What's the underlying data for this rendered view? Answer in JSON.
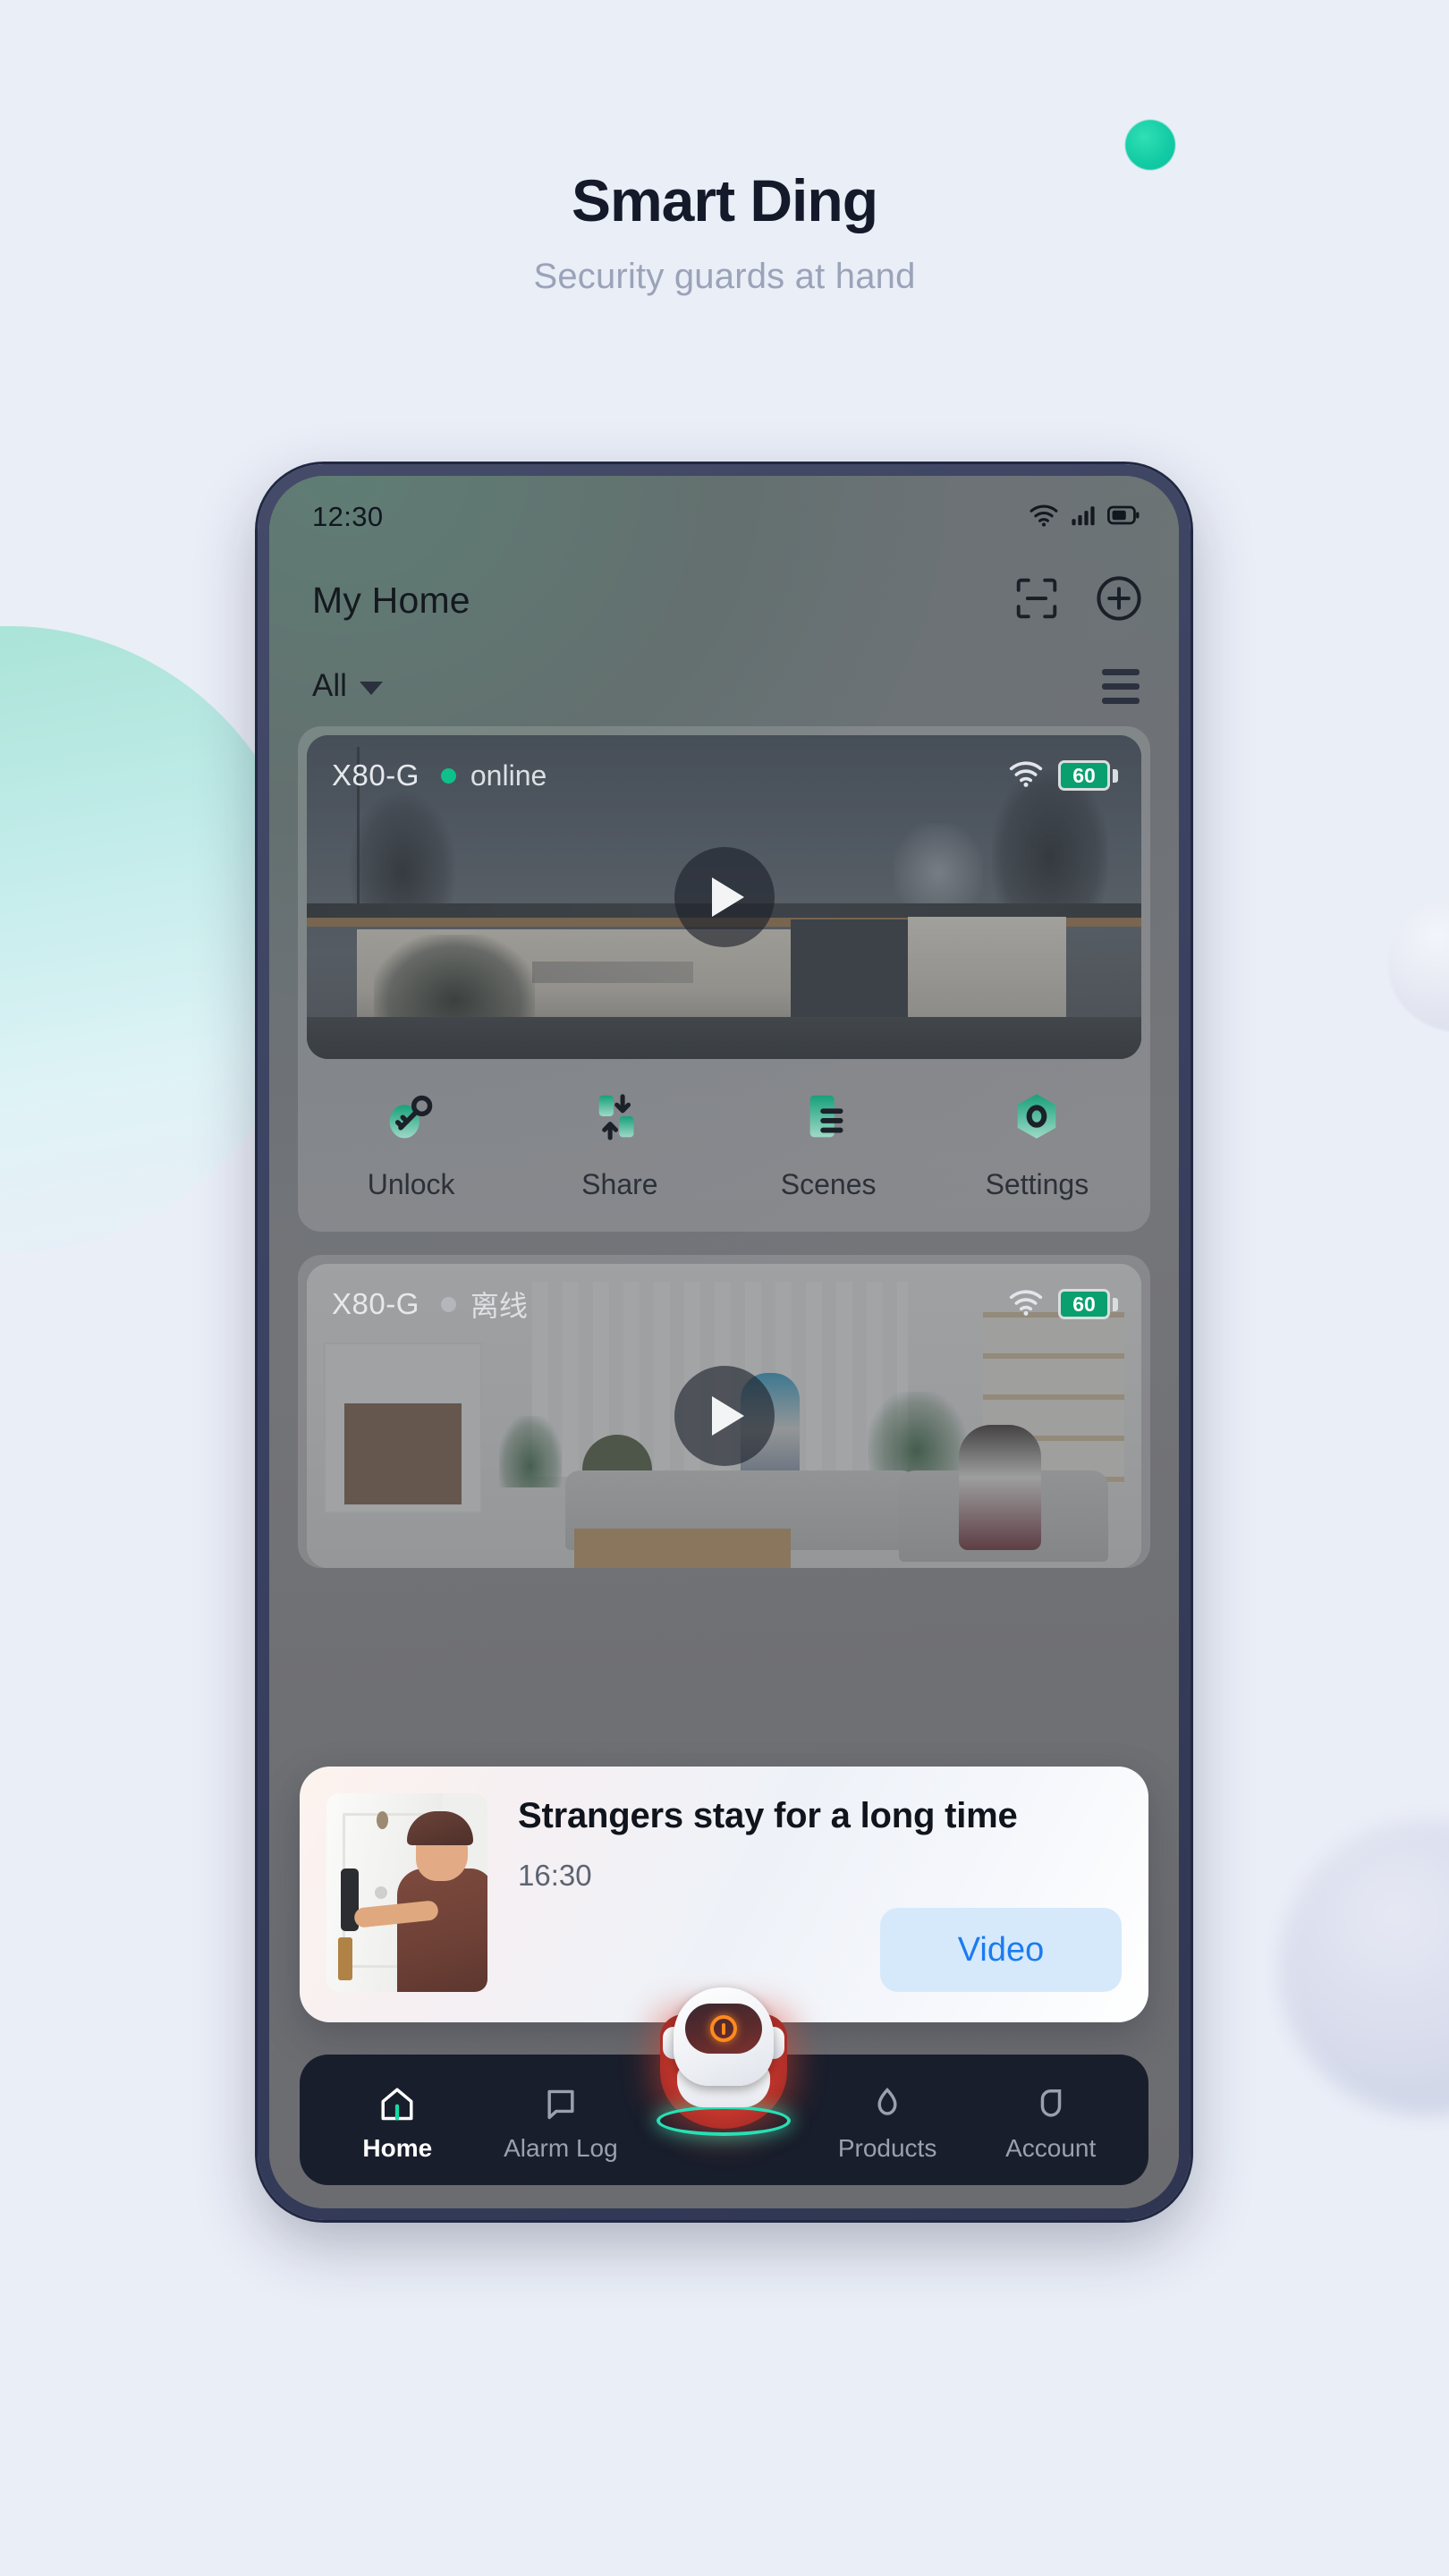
{
  "page": {
    "title": "Smart Ding",
    "subtitle": "Security guards at hand",
    "accent_green": "#12cba4",
    "background": "#eaeef7"
  },
  "phone": {
    "status_bar": {
      "time": "12:30",
      "icons": [
        "wifi-icon",
        "cellular-signal-icon",
        "battery-icon"
      ]
    },
    "app_bar": {
      "title": "My Home",
      "actions": [
        {
          "name": "scan-button",
          "icon": "scan-icon"
        },
        {
          "name": "add-device-button",
          "icon": "plus-circle-icon"
        }
      ]
    },
    "filter_bar": {
      "selected": "All",
      "dropdown_icon": "chevron-down-icon",
      "view_toggle_icon": "hamburger-menu-icon"
    },
    "devices": [
      {
        "name": "X80-G",
        "status": "online",
        "status_state": "online",
        "wifi": "wifi-icon",
        "battery": "60",
        "play_icon": "play-icon",
        "actions": [
          {
            "label": "Unlock",
            "icon": "key-unlock-icon"
          },
          {
            "label": "Share",
            "icon": "share-swap-icon"
          },
          {
            "label": "Scenes",
            "icon": "scenes-list-icon"
          },
          {
            "label": "Settings",
            "icon": "settings-hexagon-icon"
          }
        ]
      },
      {
        "name": "X80-G",
        "status": "离线",
        "status_state": "offline",
        "wifi": "wifi-icon",
        "battery": "60",
        "play_icon": "play-icon"
      }
    ],
    "toast": {
      "thumbnail": "doorbell-visitor-thumbnail",
      "title": "Strangers stay for a long time",
      "time": "16:30",
      "button_label": "Video",
      "button_color": "#1b7cf0"
    },
    "bottom_nav": {
      "items": [
        {
          "label": "Home",
          "icon": "home-icon",
          "active": true
        },
        {
          "label": "Alarm Log",
          "icon": "chat-bubble-icon",
          "active": false
        },
        {
          "label": "Products",
          "icon": "leaf-drop-icon",
          "active": false
        },
        {
          "label": "Account",
          "icon": "person-outline-icon",
          "active": false
        }
      ],
      "center": {
        "name": "assistant-robot-button",
        "icon": "robot-alert-icon"
      }
    }
  }
}
